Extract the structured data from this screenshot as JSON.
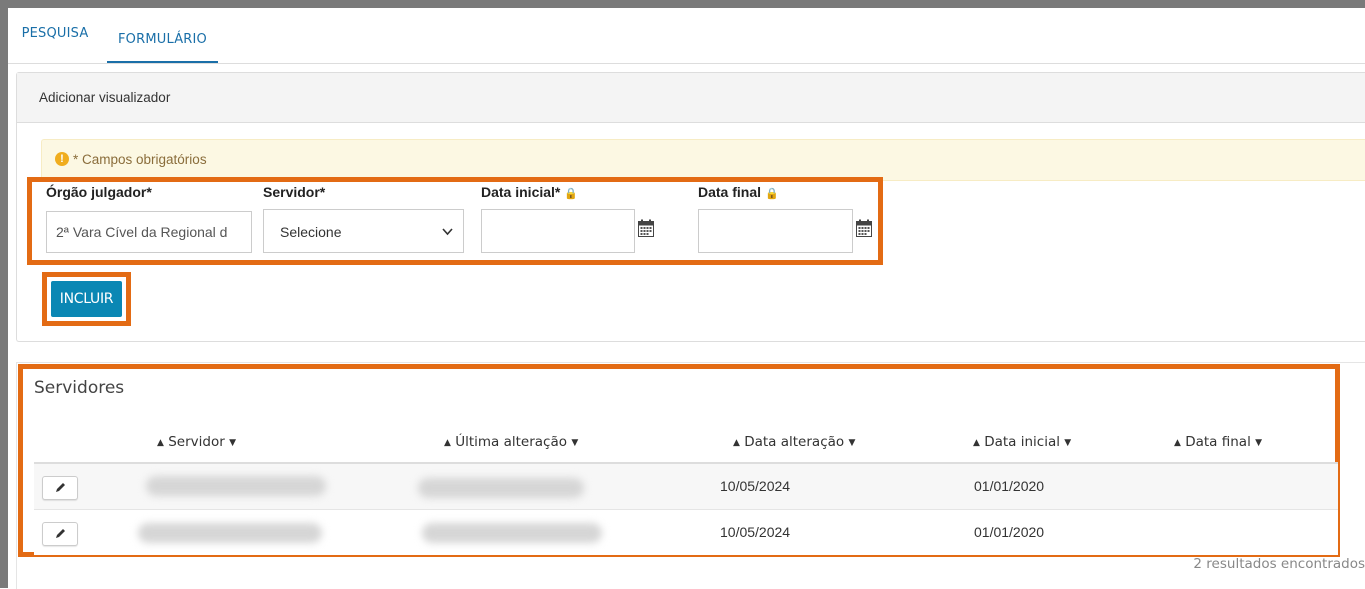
{
  "tabs": [
    {
      "label": "PESQUISA"
    },
    {
      "label": "FORMULÁRIO"
    }
  ],
  "panel": {
    "title": "Adicionar visualizador",
    "alert": "* Campos obrigatórios",
    "alert_icon": "exclamation-circle-icon"
  },
  "form": {
    "orgao": {
      "label": "Órgão julgador*",
      "value": "2ª Vara Cível da Regional d"
    },
    "servidor": {
      "label": "Servidor*",
      "value": "Selecione"
    },
    "data_inicial": {
      "label": "Data inicial*",
      "value": ""
    },
    "data_final": {
      "label": "Data final",
      "value": ""
    },
    "submit_label": "INCLUIR"
  },
  "results": {
    "title": "Servidores",
    "columns": [
      "Servidor",
      "Última alteração",
      "Data alteração",
      "Data inicial",
      "Data final"
    ],
    "rows": [
      {
        "servidor": "",
        "ultima_alteracao": "",
        "data_alteracao": "10/05/2024",
        "data_inicial": "01/01/2020",
        "data_final": ""
      },
      {
        "servidor": "",
        "ultima_alteracao": "",
        "data_alteracao": "10/05/2024",
        "data_inicial": "01/01/2020",
        "data_final": ""
      }
    ],
    "count_text": "2 resultados encontrados"
  },
  "colors": {
    "accent": "#1a6fa8",
    "button": "#0a87b4",
    "highlight": "#e36b14",
    "alert_bg": "#fcf8e3"
  }
}
